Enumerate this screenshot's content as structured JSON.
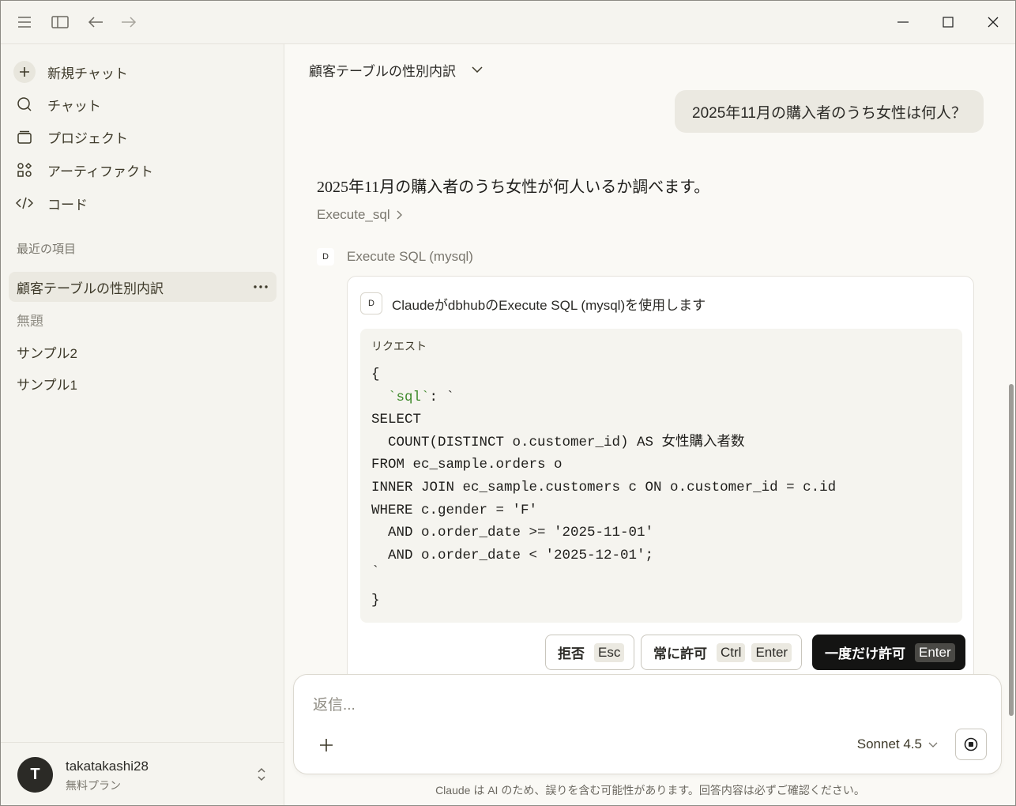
{
  "titlebar": {
    "menu_icon": "hamburger-icon",
    "sidebar_icon": "sidebar-toggle-icon",
    "back_icon": "arrow-left-icon",
    "forward_icon": "arrow-right-icon"
  },
  "sidebar": {
    "nav": [
      {
        "label": "新規チャット",
        "icon": "plus-icon"
      },
      {
        "label": "チャット",
        "icon": "chat-icon"
      },
      {
        "label": "プロジェクト",
        "icon": "folder-stack-icon"
      },
      {
        "label": "アーティファクト",
        "icon": "shapes-icon"
      },
      {
        "label": "コード",
        "icon": "code-icon"
      }
    ],
    "recent_label": "最近の項目",
    "recent": [
      {
        "label": "顧客テーブルの性別内訳",
        "active": true
      },
      {
        "label": "無題",
        "muted": true
      },
      {
        "label": "サンプル2"
      },
      {
        "label": "サンプル1"
      }
    ],
    "user": {
      "initial": "T",
      "name": "takatakashi28",
      "plan": "無料プラン"
    }
  },
  "conversation": {
    "title": "顧客テーブルの性別内訳",
    "user_message": "2025年11月の購入者のうち女性は何人？",
    "assistant_text": "2025年11月の購入者のうち女性が何人いるか調べます。",
    "tool_link": "Execute_sql",
    "tool_head_badge": "D",
    "tool_head": "Execute SQL (mysql)",
    "card": {
      "badge": "D",
      "title": "ClaudeがdbhubのExecute SQL (mysql)を使用します",
      "request_label": "リクエスト",
      "code_lines": [
        "{",
        "SELECT",
        "  COUNT(DISTINCT o.customer_id) AS 女性購入者数",
        "FROM ec_sample.orders o",
        "INNER JOIN ec_sample.customers c ON o.customer_id = c.id",
        "WHERE c.gender = 'F'",
        "  AND o.order_date >= '2025-11-01'",
        "  AND o.order_date < '2025-12-01';",
        "`",
        "}"
      ],
      "code_key": "`sql`",
      "code_key_suffix": ": `",
      "buttons": {
        "deny": {
          "label": "拒否",
          "kbd": "Esc"
        },
        "always": {
          "label": "常に許可",
          "kbd1": "Ctrl",
          "kbd2": "Enter"
        },
        "once": {
          "label": "一度だけ許可",
          "kbd": "Enter"
        }
      }
    }
  },
  "composer": {
    "placeholder": "返信...",
    "model": "Sonnet 4.5"
  },
  "disclaimer": "Claude は AI のため、誤りを含む可能性があります。回答内容は必ずご確認ください。"
}
